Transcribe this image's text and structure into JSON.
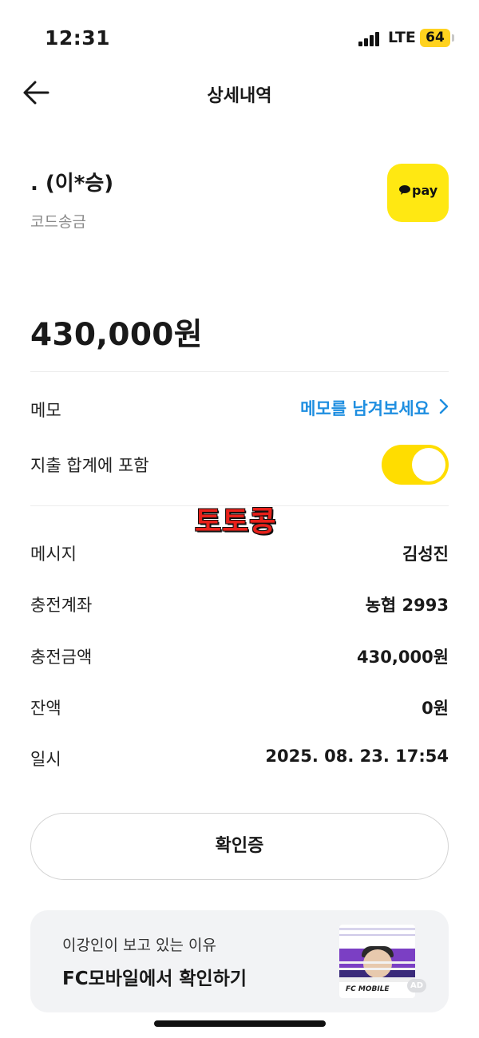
{
  "status_bar": {
    "time": "12:31",
    "network": "LTE",
    "battery": "64"
  },
  "nav": {
    "title": "상세내역",
    "back_icon": "arrow-left-icon"
  },
  "header": {
    "recipient": ". (이*승)",
    "type": "코드송금",
    "badge_text": "pay",
    "badge_color": "#ffe812"
  },
  "amount": "430,000원",
  "memo": {
    "label": "메모",
    "link_text": "메모를 남겨보세요",
    "link_color": "#1e8ee0"
  },
  "expense_toggle": {
    "label": "지출 합계에 포함",
    "enabled": true,
    "color": "#ffdd00"
  },
  "watermark": "토토콩",
  "details": [
    {
      "label": "메시지",
      "value": "김성진"
    },
    {
      "label": "충전계좌",
      "value": "농협 2993"
    },
    {
      "label": "충전금액",
      "value": "430,000원"
    },
    {
      "label": "잔액",
      "value": "0원"
    },
    {
      "label": "일시",
      "value": "2025. 08. 23. 17:54"
    }
  ],
  "confirm_button": "확인증",
  "ad": {
    "subtitle": "이강인이 보고 있는 이유",
    "title": "FC모바일에서 확인하기",
    "logo_text": "FC MOBILE",
    "badge": "AD"
  }
}
